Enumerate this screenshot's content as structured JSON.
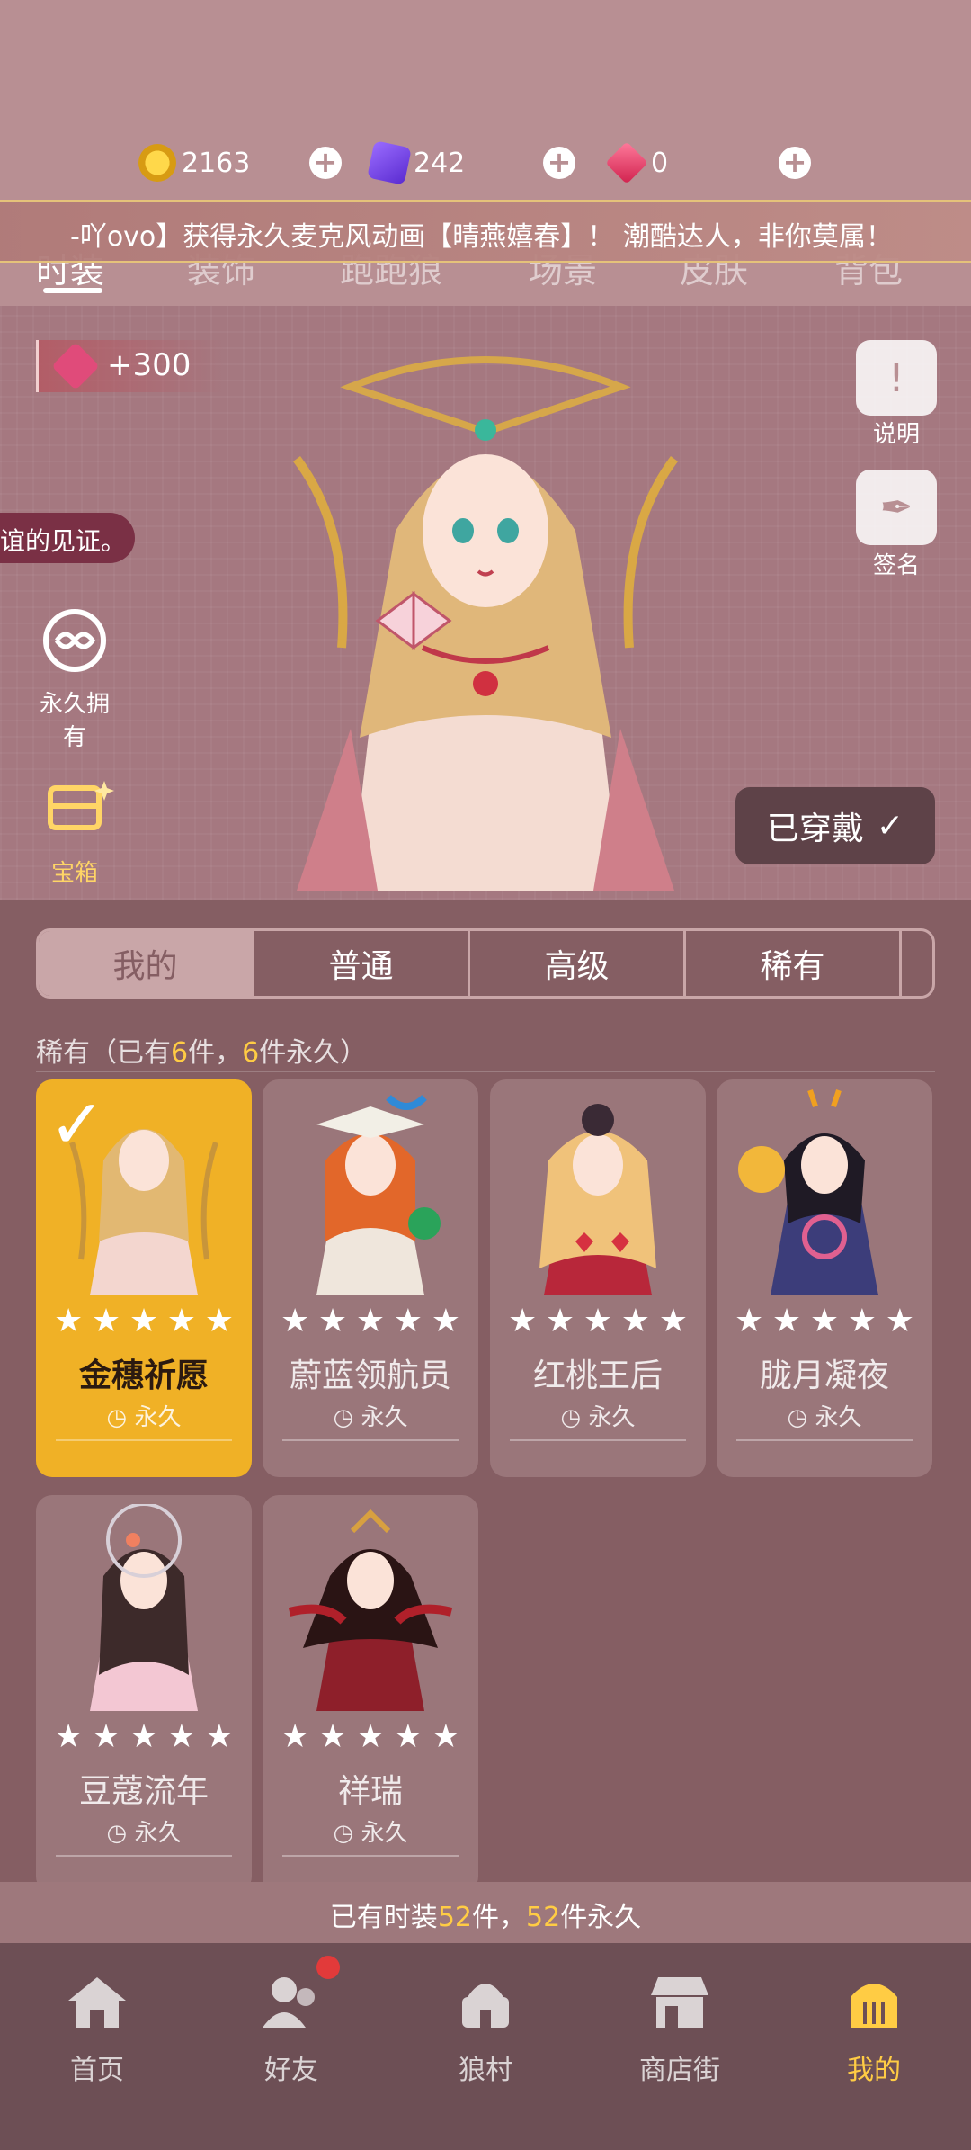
{
  "currency": {
    "coins": "2163",
    "cards": "242",
    "gems": "0"
  },
  "marquee": "-吖ovo】获得永久麦克风动画【晴燕嬉春】！ 潮酷达人，非你莫属！",
  "top_tabs": [
    "时装",
    "装饰",
    "跑跑狼",
    "场景",
    "皮肤",
    "背包"
  ],
  "hero": {
    "gem_bonus": "+300",
    "toast": "谊的见证。",
    "side_buttons": {
      "info": "说明",
      "sign": "签名"
    },
    "left_items": {
      "permanent": "永久拥有",
      "chest": "宝箱"
    },
    "worn_label": "已穿戴"
  },
  "segments": [
    "我的",
    "普通",
    "高级",
    "稀有"
  ],
  "rare_summary": {
    "prefix": "稀有（已有",
    "owned": "6",
    "mid": "件，",
    "perm": "6",
    "suffix": "件永久）"
  },
  "cards": [
    {
      "name": "金穗祈愿",
      "perm": "永久",
      "stars": 5,
      "selected": true
    },
    {
      "name": "蔚蓝领航员",
      "perm": "永久",
      "stars": 5
    },
    {
      "name": "红桃王后",
      "perm": "永久",
      "stars": 5
    },
    {
      "name": "胧月凝夜",
      "perm": "永久",
      "stars": 5
    },
    {
      "name": "豆蔻流年",
      "perm": "永久",
      "stars": 5
    },
    {
      "name": "祥瑞",
      "perm": "永久",
      "stars": 5
    }
  ],
  "summary": {
    "prefix": "已有时装",
    "total": "52",
    "mid": "件，",
    "perm": "52",
    "suffix": "件永久"
  },
  "nav": [
    "首页",
    "好友",
    "狼村",
    "商店街",
    "我的"
  ],
  "colors": {
    "accent": "#ffcc44",
    "selected_card": "#f0b126",
    "background": "#b88f93"
  }
}
